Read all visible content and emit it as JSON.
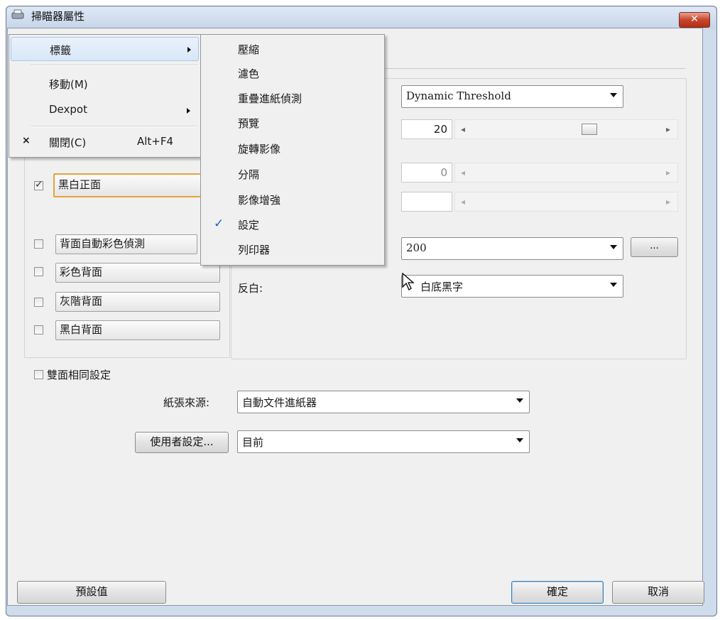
{
  "window": {
    "title": "掃瞄器屬性",
    "close_label": "✕"
  },
  "system_menu": {
    "items": [
      {
        "label": "標籤",
        "has_submenu": true,
        "highlighted": true
      },
      {
        "label": "移動(M)"
      },
      {
        "label": "Dexpot",
        "has_submenu": true
      },
      {
        "label": "關閉(C)",
        "shortcut": "Alt+F4",
        "icon": "close-x-icon"
      }
    ]
  },
  "submenu": {
    "items": [
      {
        "label": "壓縮"
      },
      {
        "label": "濾色"
      },
      {
        "label": "重疊進紙偵測"
      },
      {
        "label": "預覽"
      },
      {
        "label": "旋轉影像"
      },
      {
        "label": "分隔"
      },
      {
        "label": "影像增強"
      },
      {
        "label": "設定",
        "checked": true,
        "check_glyph": "✓"
      },
      {
        "label": "列印器"
      }
    ]
  },
  "image_list": {
    "items": [
      {
        "label": "黑白正面",
        "checked": true,
        "selected": true
      },
      {
        "label": "背面自動彩色偵測",
        "checked": false
      },
      {
        "label": "彩色背面",
        "checked": false
      },
      {
        "label": "灰階背面",
        "checked": false
      },
      {
        "label": "黑白背面",
        "checked": false
      }
    ]
  },
  "settings": {
    "binarization_value": "Dynamic Threshold",
    "threshold_value": "20",
    "contrast_value": "0",
    "resolution_value": "200",
    "more_button": "...",
    "invert_label": "反白:",
    "invert_value": "白底黑字"
  },
  "duplex_same": {
    "label": "雙面相同設定",
    "checked": false
  },
  "paper_source": {
    "label": "紙張來源:",
    "value": "自動文件進紙器"
  },
  "user_settings": {
    "button": "使用者設定...",
    "value": "目前"
  },
  "footer": {
    "default_button": "預設值",
    "ok_button": "確定",
    "cancel_button": "取消"
  },
  "colors": {
    "highlight": "#d8e7f7",
    "selected_border": "#e8a23a",
    "check": "#1b64c7",
    "close": "#c6452c"
  }
}
